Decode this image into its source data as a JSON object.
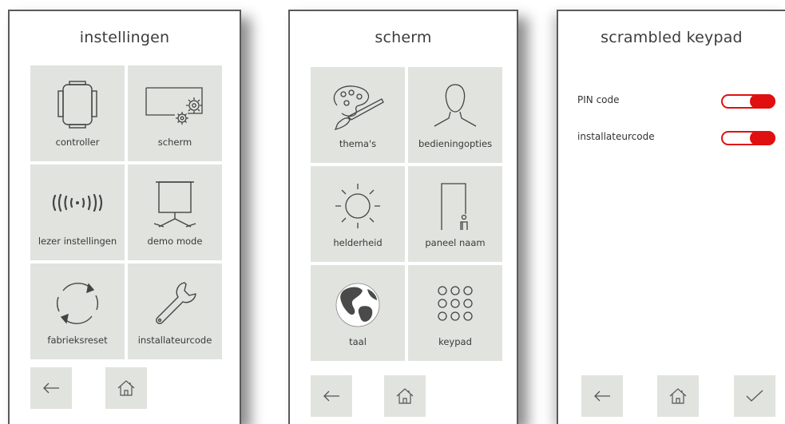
{
  "panels": [
    {
      "title": "instellingen",
      "tiles": [
        {
          "label": "controller",
          "icon": "controller-icon"
        },
        {
          "label": "scherm",
          "icon": "screen-settings-icon"
        },
        {
          "label": "lezer instellingen",
          "icon": "reader-waves-icon"
        },
        {
          "label": "demo mode",
          "icon": "projector-screen-icon"
        },
        {
          "label": "fabrieksreset",
          "icon": "reset-arrows-icon"
        },
        {
          "label": "installateurcode",
          "icon": "wrench-icon"
        }
      ]
    },
    {
      "title": "scherm",
      "tiles": [
        {
          "label": "thema's",
          "icon": "palette-icon"
        },
        {
          "label": "bedieningopties",
          "icon": "person-silhouette-icon"
        },
        {
          "label": "helderheid",
          "icon": "sun-icon"
        },
        {
          "label": "paneel naam",
          "icon": "door-person-icon"
        },
        {
          "label": "taal",
          "icon": "globe-icon"
        },
        {
          "label": "keypad",
          "icon": "keypad-icon"
        }
      ]
    },
    {
      "title": "scrambled keypad",
      "settings": [
        {
          "label": "PIN code",
          "enabled": true
        },
        {
          "label": "installateurcode",
          "enabled": true
        }
      ]
    }
  ],
  "nav": {
    "back_icon": "arrow-left-icon",
    "home_icon": "home-icon",
    "confirm_icon": "checkmark-icon"
  },
  "colors": {
    "tile": "#e1e3de",
    "toggle_on": "#e01010",
    "border": "#5a5a5a"
  }
}
